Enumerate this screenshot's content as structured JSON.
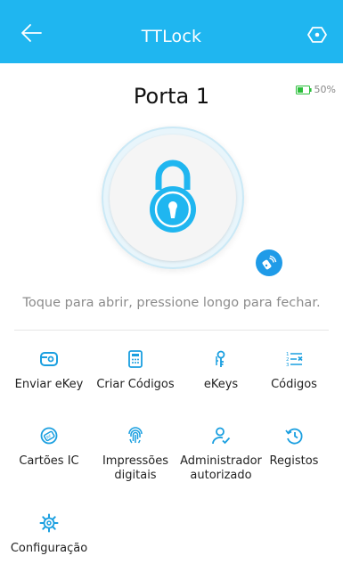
{
  "header": {
    "title": "TTLock",
    "back_icon": "back-arrow-icon",
    "settings_icon": "settings-icon",
    "background_color": "#1fb6f0"
  },
  "lock": {
    "name": "Porta 1",
    "battery_label": "50%",
    "battery_level": 0.5,
    "lock_icon": "padlock-icon",
    "remote_icon": "remote-unlock-icon",
    "hint": "Toque para abrir, pressione longo para fechar."
  },
  "menu": {
    "items": [
      {
        "label": "Enviar eKey",
        "icon": "send-ekey-icon"
      },
      {
        "label": "Criar Códigos",
        "icon": "calculator-icon"
      },
      {
        "label": "eKeys",
        "icon": "keys-icon"
      },
      {
        "label": "Códigos",
        "icon": "codes-list-icon"
      },
      {
        "label": "Cartões IC",
        "icon": "ic-card-icon"
      },
      {
        "label": "Impressões\ndigitais",
        "icon": "fingerprint-icon"
      },
      {
        "label": "Administrador\nautorizado",
        "icon": "admin-user-icon"
      },
      {
        "label": "Registos",
        "icon": "history-icon"
      },
      {
        "label": "Configuração",
        "icon": "gear-icon"
      }
    ]
  },
  "colors": {
    "accent": "#1fb6f0",
    "icon_blue": "#1a9fe0"
  }
}
